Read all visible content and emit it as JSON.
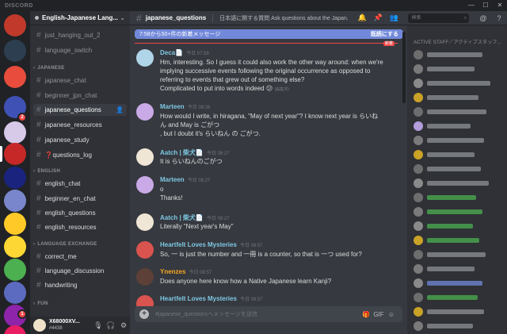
{
  "app": {
    "title": "DISCORD"
  },
  "window_controls": [
    "—",
    "☐",
    "✕"
  ],
  "guild": {
    "name": "English-Japanese Lang..."
  },
  "channels": {
    "top": [
      {
        "name": "just_hanging_out_2"
      },
      {
        "name": "language_switch"
      }
    ],
    "categories": [
      {
        "label": "JAPANESE",
        "items": [
          "japanese_chat",
          "beginner_jpn_chat",
          "japanese_questions",
          "japanese_resources",
          "japanese_study",
          "❓questions_log"
        ]
      },
      {
        "label": "ENGLISH",
        "items": [
          "english_chat",
          "beginner_en_chat",
          "english_questions",
          "english_resources"
        ]
      },
      {
        "label": "LANGUAGE EXCHANGE",
        "items": [
          "correct_me",
          "language_discussion",
          "handwriting"
        ]
      },
      {
        "label": "FUN",
        "items": []
      }
    ]
  },
  "user": {
    "name": "X68000XV...",
    "tag": "#4438"
  },
  "header": {
    "channel": "japanese_questions",
    "topic": "日本語に関する質問 Ask questions about the Japan...",
    "search_placeholder": "検索"
  },
  "newbar": {
    "text": "7:58から50+件の新着メッセージ",
    "mark_read": "既読にする",
    "new_tag": "新着"
  },
  "messages": [
    {
      "author": "Deca📄",
      "time": "今日 07:58",
      "lines": [
        "Hm, interesting. So I guess it could also work the other way around: when we're",
        "implying successive events following the original occurrence as opposed to",
        "referring to events that grew out of something else?",
        "Complicated to put into words indeed 😕"
      ],
      "edited": "(編集済)"
    },
    {
      "author": "Marteen",
      "time": "今日 08:26",
      "lines": [
        "How would I write, in hiragana, \"May of next year\"? I know next year is らいね",
        "ん and May is ごがつ",
        ", but I doubt it's らいねん の ごがつ."
      ]
    },
    {
      "author": "Aatch | 柴犬📄",
      "time": "今日 08:27",
      "lines": [
        "It is らいねんのごがつ"
      ],
      "orange": true
    },
    {
      "author": "Marteen",
      "time": "今日 08:27",
      "lines": [
        "o",
        "Thanks!"
      ]
    },
    {
      "author": "Aatch | 柴犬📄",
      "time": "今日 08:27",
      "lines": [
        "Literally \"Next year's May\""
      ],
      "orange": true
    },
    {
      "author": "Heartfelt Loves Mysteries",
      "time": "今日 08:57",
      "lines": [
        "So, 一 is just the number and  一冊 is a counter, so that is  一つ used for?"
      ]
    },
    {
      "author": "Ynenzes",
      "time": "今日 08:57",
      "lines": [
        "Does anyone here know how a Native Japanese learn Kanji?"
      ],
      "orange": true
    },
    {
      "author": "Heartfelt Loves Mysteries",
      "time": "今日 08:57",
      "lines": [
        ""
      ]
    }
  ],
  "composer": {
    "placeholder": "#japanese_questionsへメッセージを送信"
  },
  "members": {
    "category": "ACTIVE STAFF／アクティブスタッフ..."
  },
  "colors": {
    "accent": "#7289da",
    "danger": "#f04747",
    "link": "#7ec8e3",
    "orange": "#f5a623"
  }
}
